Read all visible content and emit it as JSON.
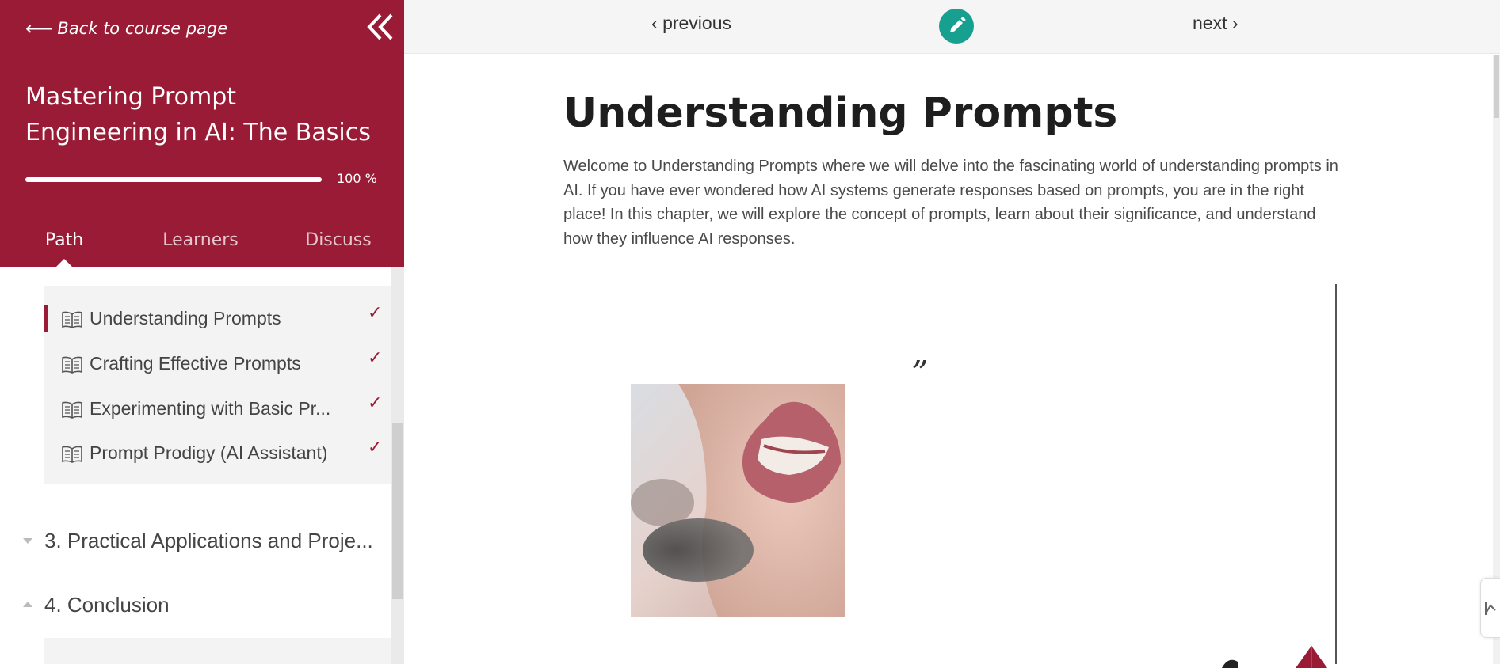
{
  "sidebar": {
    "back_label": "Back to course page",
    "course_title": "Mastering Prompt Engineering in AI: The Basics",
    "progress": {
      "value": 1.0,
      "label": "100 %"
    },
    "tabs": [
      {
        "label": "Path",
        "active": true
      },
      {
        "label": "Learners",
        "active": false
      },
      {
        "label": "Discuss",
        "active": false
      }
    ],
    "lessons": [
      {
        "label": "Understanding Prompts",
        "check": "✓",
        "current": true
      },
      {
        "label": "Crafting Effective Prompts",
        "check": "✓",
        "current": false
      },
      {
        "label": "Experimenting with Basic Pr...",
        "check": "✓",
        "current": false
      },
      {
        "label": "Prompt Prodigy (AI Assistant)",
        "check": "✓",
        "current": false
      }
    ],
    "sections": [
      {
        "label": "3. Practical Applications and Proje...",
        "expanded": false
      },
      {
        "label": "4. Conclusion",
        "expanded": true
      }
    ]
  },
  "topbar": {
    "previous_label": "previous",
    "next_label": "next"
  },
  "main": {
    "title": "Understanding Prompts",
    "intro": "Welcome to Understanding Prompts where we will delve into the fascinating world of understanding prompts in AI. If you have ever wondered how AI systems generate responses based on prompts, you are in the right place! In this chapter, we will explore the concept of prompts, learn about their significance, and understand how they influence AI responses.",
    "quote_mark": "”"
  },
  "colors": {
    "brand": "#9a1b36",
    "edit_button": "#17a090",
    "topbar": "#f5f5f5"
  },
  "icons": {
    "back": "arrow-left-icon",
    "collapse": "double-chevron-left-icon",
    "lesson": "open-book-icon",
    "edit": "pencil-icon"
  }
}
